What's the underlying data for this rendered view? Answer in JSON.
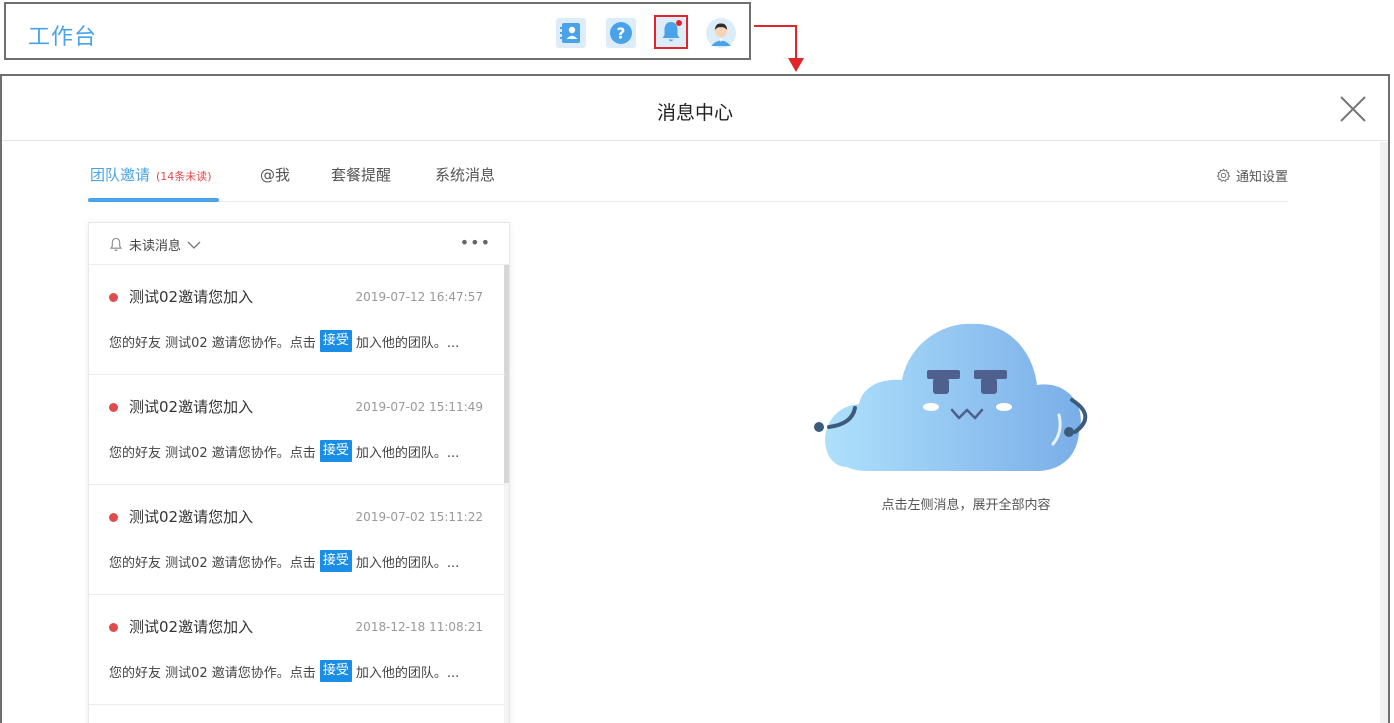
{
  "topbar": {
    "title": "工作台",
    "icons": [
      "contacts-icon",
      "help-icon",
      "bell-icon",
      "avatar"
    ]
  },
  "panel": {
    "title": "消息中心",
    "tabs": [
      {
        "label": "团队邀请",
        "badge": "(14条未读)"
      },
      {
        "label": "@我"
      },
      {
        "label": "套餐提醒"
      },
      {
        "label": "系统消息"
      }
    ],
    "settings_label": "通知设置"
  },
  "list": {
    "filter_label": "未读消息",
    "more_label": "•••",
    "items": [
      {
        "title": "测试02邀请您加入",
        "time": "2019-07-12 16:47:57",
        "body_before": "您的好友 测试02 邀请您协作。点击",
        "accept": "接受",
        "body_after": "加入他的团队。..."
      },
      {
        "title": "测试02邀请您加入",
        "time": "2019-07-02 15:11:49",
        "body_before": "您的好友 测试02 邀请您协作。点击",
        "accept": "接受",
        "body_after": "加入他的团队。..."
      },
      {
        "title": "测试02邀请您加入",
        "time": "2019-07-02 15:11:22",
        "body_before": "您的好友 测试02 邀请您协作。点击",
        "accept": "接受",
        "body_after": "加入他的团队。..."
      },
      {
        "title": "测试02邀请您加入",
        "time": "2018-12-18 11:08:21",
        "body_before": "您的好友 测试02 邀请您协作。点击",
        "accept": "接受",
        "body_after": "加入他的团队。..."
      }
    ]
  },
  "empty_state": {
    "text": "点击左侧消息，展开全部内容"
  },
  "colors": {
    "accent": "#4aa3e8",
    "unread_dot": "#e04b4b",
    "accept_bg": "#1a8ee6",
    "highlight": "#e0262b"
  }
}
